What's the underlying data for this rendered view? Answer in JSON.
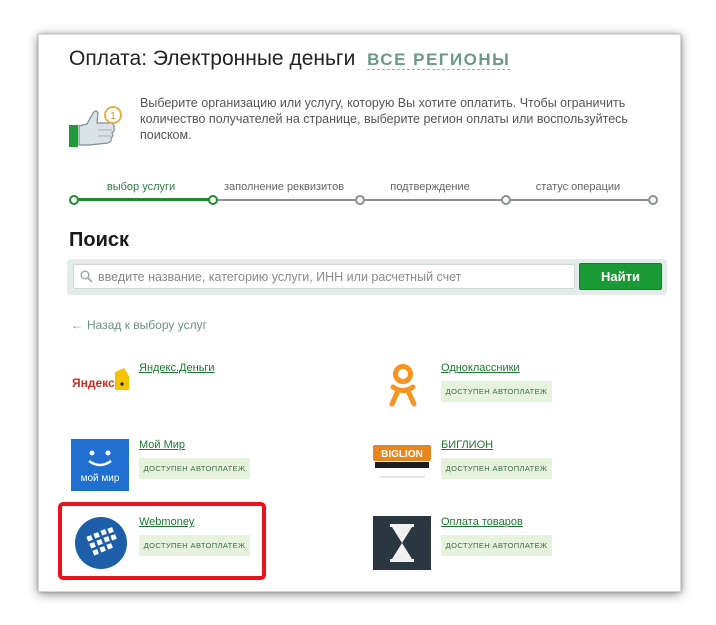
{
  "header": {
    "title": "Оплата: Электронные деньги",
    "region_link": "ВСЕ РЕГИОНЫ"
  },
  "hint": {
    "icon": "thumbs-up-icon",
    "badge_number": "1",
    "text": "Выберите организацию или услугу, которую Вы хотите оплатить. Чтобы ограничить количество получателей на странице, выберите регион оплаты или воспользуйтесь поиском."
  },
  "stepper": {
    "steps": [
      {
        "label": "выбор услуги",
        "active": true
      },
      {
        "label": "заполнение реквизитов",
        "active": false
      },
      {
        "label": "подтверждение",
        "active": false
      },
      {
        "label": "статус операции",
        "active": false
      }
    ]
  },
  "search": {
    "heading": "Поиск",
    "placeholder": "введите название, категорию услуги, ИНН или расчетный счет",
    "value": "",
    "button_label": "Найти"
  },
  "back_link": "Назад к выбору услуг",
  "services": [
    {
      "name": "Яндекс.Деньги",
      "badge": "",
      "logo": "yandex-money-logo",
      "logo_text": "Яндекс"
    },
    {
      "name": "Одноклассники",
      "badge": "доступен автоплатеж",
      "logo": "odnoklassniki-logo"
    },
    {
      "name": "Мой Мир",
      "badge": "доступен автоплатеж",
      "logo": "moy-mir-logo",
      "logo_text": "мой мир"
    },
    {
      "name": "БИГЛИОН",
      "badge": "доступен автоплатеж",
      "logo": "biglion-logo",
      "logo_text": "BIGLION"
    },
    {
      "name": "Webmoney",
      "badge": "доступен автоплатеж",
      "logo": "webmoney-logo"
    },
    {
      "name": "Оплата товаров",
      "badge": "доступен автоплатеж",
      "logo": "hourglass-logo"
    }
  ],
  "colors": {
    "accent_green": "#1a9a34",
    "link_green": "#1a7a2e",
    "badge_bg": "#e5f3dc",
    "highlight_red": "#e8131c"
  }
}
